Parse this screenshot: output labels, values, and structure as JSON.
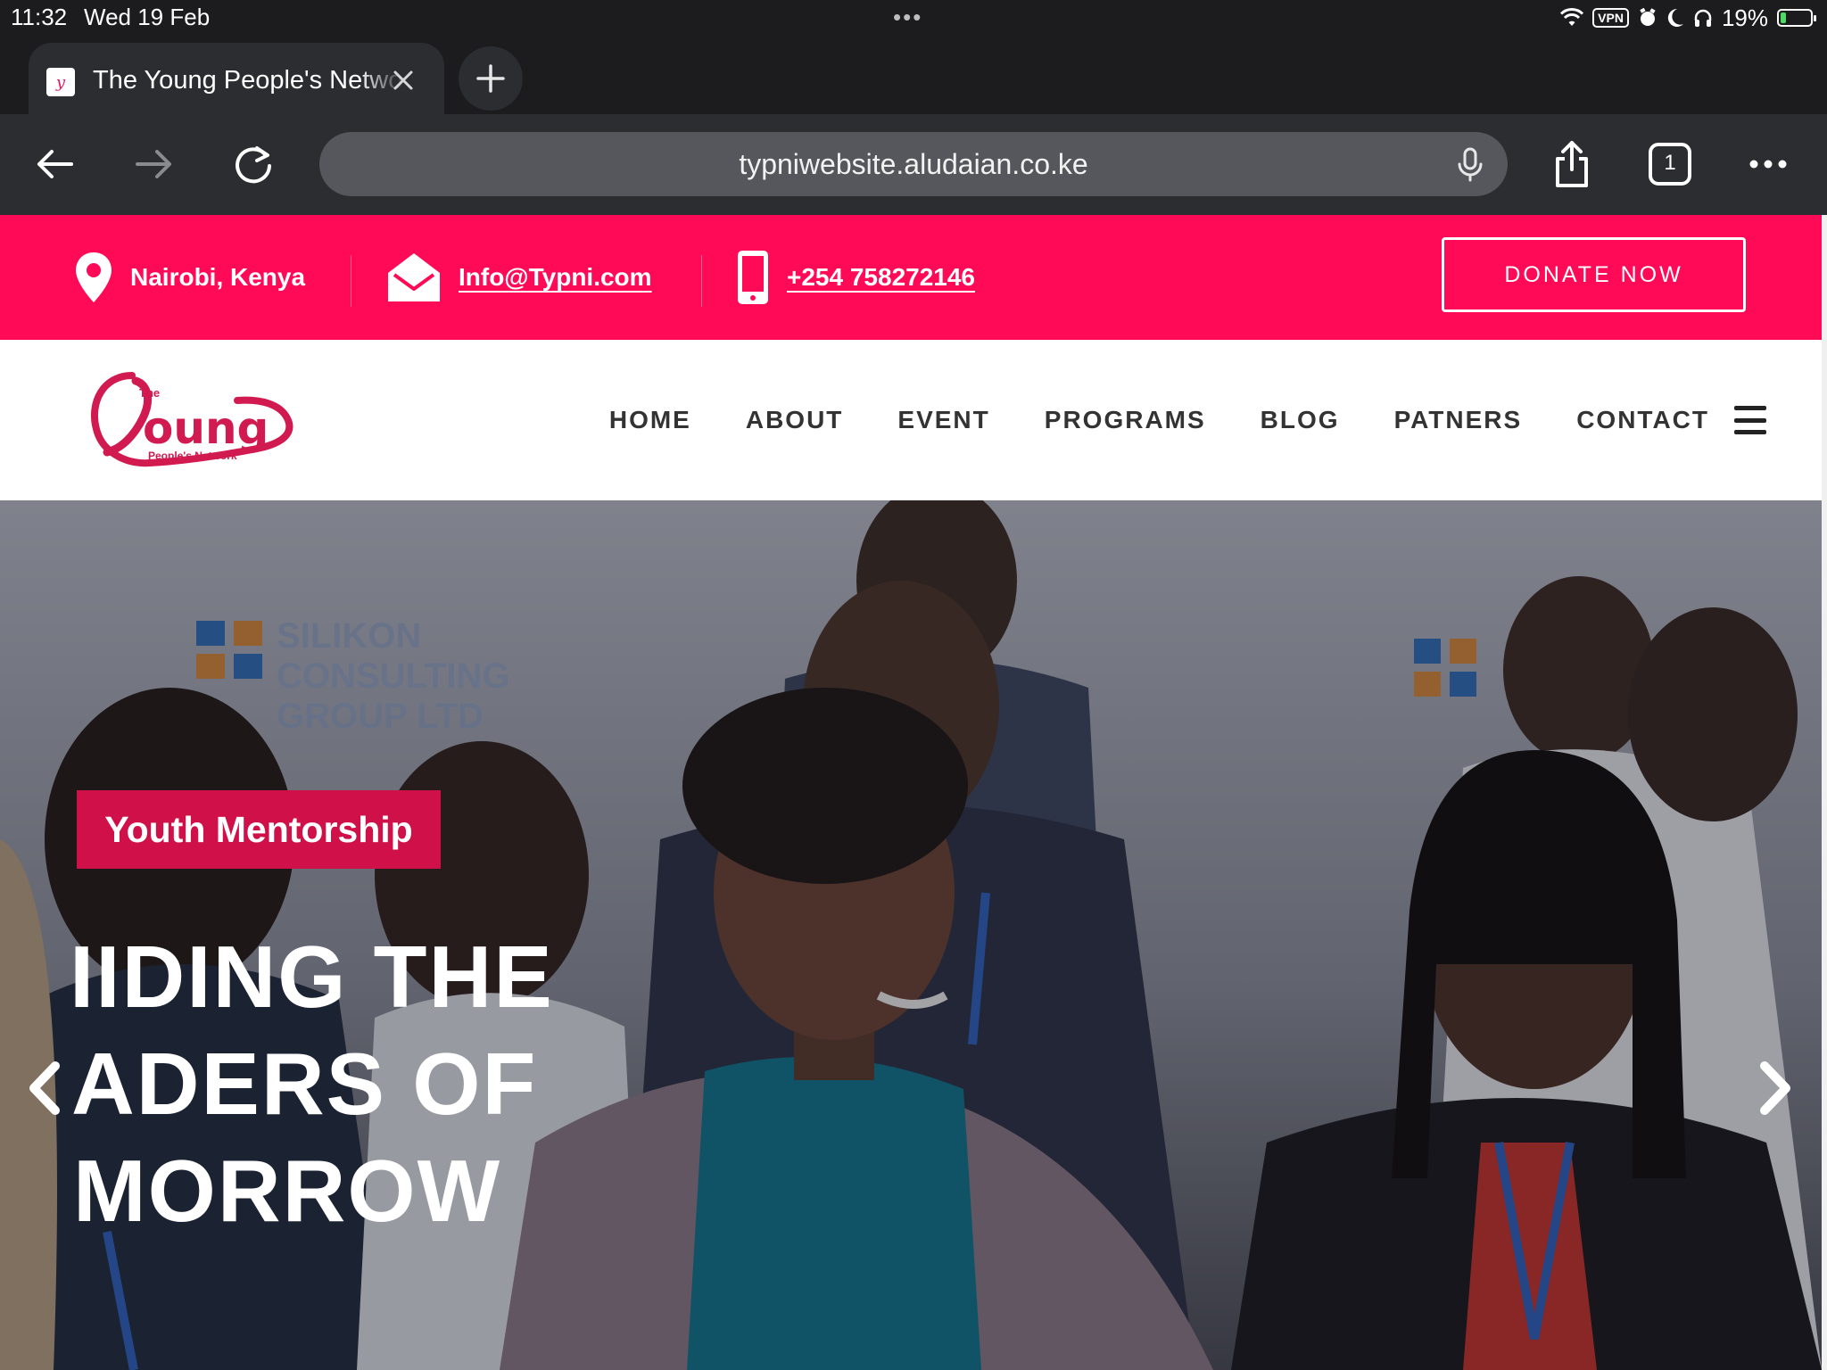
{
  "status_bar": {
    "time": "11:32",
    "date": "Wed 19 Feb",
    "dots": "•••",
    "vpn": "VPN",
    "battery": "19%",
    "battery_level": 0.19
  },
  "browser": {
    "tab_title": "The Young People's Network",
    "url": "typniwebsite.aludaian.co.ke",
    "tab_count": "1"
  },
  "site": {
    "topbar": {
      "location": "Nairobi, Kenya",
      "email": "Info@Typni.com",
      "phone": "+254 758272146",
      "donate": "DONATE NOW"
    },
    "logo": {
      "the": "The",
      "main": "Young",
      "sub": "People's Network"
    },
    "nav": [
      "HOME",
      "ABOUT",
      "EVENT",
      "PROGRAMS",
      "BLOG",
      "PATNERS",
      "CONTACT"
    ],
    "hero": {
      "badge": "Youth Mentorship",
      "line1": "IIDING THE",
      "line2": "ADERS OF",
      "line3": "MORROW",
      "backdrop_text_left": "SILIKON CONSULTING GROUP LTD"
    }
  },
  "colors": {
    "brand_pink": "#ff0a57",
    "badge_pink": "#d01049"
  }
}
